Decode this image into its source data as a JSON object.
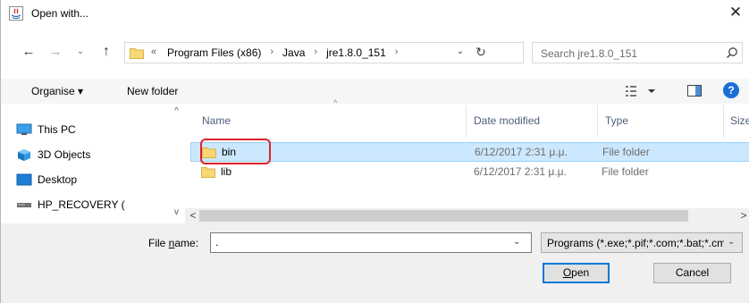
{
  "window": {
    "title": "Open with...",
    "close_glyph": "✕"
  },
  "nav": {
    "back_glyph": "←",
    "forward_glyph": "→",
    "recent_glyph": "⌄",
    "up_glyph": "↑",
    "more_glyph": "«",
    "crumbs": [
      "Program Files (x86)",
      "Java",
      "jre1.8.0_151"
    ],
    "crumb_sep": "›",
    "dropdown_glyph": "⌄",
    "refresh_glyph": "↻",
    "search_placeholder": "Search jre1.8.0_151"
  },
  "toolbar": {
    "organise_label": "Organise ▾",
    "new_folder_label": "New folder",
    "help_label": "?"
  },
  "navpane": {
    "items": [
      {
        "label": "This PC",
        "icon": "this-pc-icon"
      },
      {
        "label": "3D Objects",
        "icon": "3d-objects-icon"
      },
      {
        "label": "Desktop",
        "icon": "desktop-icon"
      },
      {
        "label": "HP_RECOVERY (",
        "icon": "drive-icon"
      }
    ],
    "scroll_up_glyph": "^",
    "scroll_down_glyph": "v"
  },
  "columns": {
    "name": "Name",
    "date": "Date modified",
    "type": "Type",
    "size": "Size"
  },
  "files": [
    {
      "name": "bin",
      "date": "6/12/2017 2:31 μ.μ.",
      "type": "File folder",
      "selected": true
    },
    {
      "name": "lib",
      "date": "6/12/2017 2:31 μ.μ.",
      "type": "File folder",
      "selected": false
    }
  ],
  "hscroll": {
    "left_glyph": "<",
    "right_glyph": ">"
  },
  "bottom": {
    "file_name_label_pre": "File ",
    "file_name_label_accel": "n",
    "file_name_label_post": "ame:",
    "file_name_value": ".",
    "file_type_value": "Programs (*.exe;*.pif;*.com;*.bat;*.cmd)",
    "open_label_accel": "O",
    "open_label_rest": "pen",
    "cancel_label": "Cancel",
    "dropdown_glyph": "⌄"
  },
  "colors": {
    "selection": "#cce8ff",
    "highlight_box": "#e0202a",
    "accent": "#0078d7"
  }
}
